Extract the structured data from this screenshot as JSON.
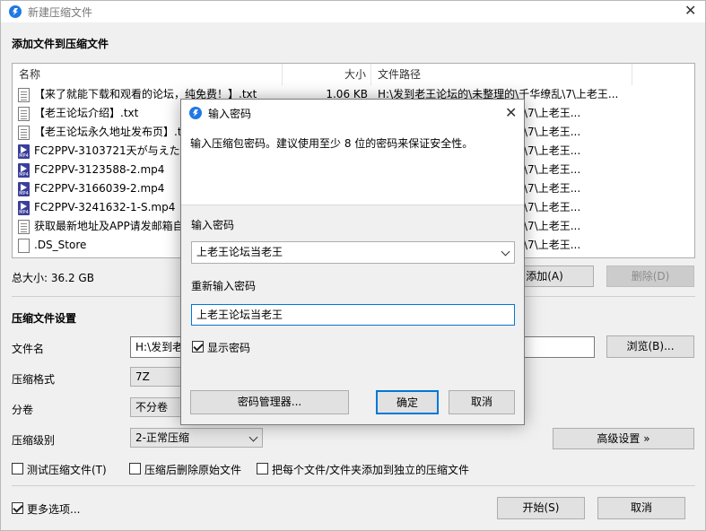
{
  "window": {
    "title": "新建压缩文件"
  },
  "add_section": {
    "title": "添加文件到压缩文件"
  },
  "file_list": {
    "columns": {
      "name": "名称",
      "size": "大小",
      "path": "文件路径"
    },
    "rows": [
      {
        "icon": "txt",
        "name": "【来了就能下载和观看的论坛，纯免费！】.txt",
        "size": "1.06 KB",
        "path": "H:\\发到老王论坛的\\未整理的\\千华缭乱\\7\\上老王..."
      },
      {
        "icon": "txt",
        "name": "【老王论坛介绍】.txt",
        "size": "",
        "path": "乱\\7\\上老王..."
      },
      {
        "icon": "txt",
        "name": "【老王论坛永久地址发布页】.tx",
        "size": "",
        "path": "乱\\7\\上老王..."
      },
      {
        "icon": "mp4",
        "name": "FC2PPV-3103721天が与えた",
        "size": "",
        "path": "乱\\7\\上老王..."
      },
      {
        "icon": "mp4",
        "name": "FC2PPV-3123588-2.mp4",
        "size": "",
        "path": "乱\\7\\上老王..."
      },
      {
        "icon": "mp4",
        "name": "FC2PPV-3166039-2.mp4",
        "size": "",
        "path": "乱\\7\\上老王..."
      },
      {
        "icon": "mp4",
        "name": "FC2PPV-3241632-1-S.mp4",
        "size": "",
        "path": "乱\\7\\上老王..."
      },
      {
        "icon": "txt",
        "name": "获取最新地址及APP请发邮箱自",
        "size": "",
        "path": "乱\\7\\上老王..."
      },
      {
        "icon": "blank",
        "name": ".DS_Store",
        "size": "",
        "path": "乱\\7\\上老王..."
      }
    ]
  },
  "total_size": "总大小: 36.2 GB",
  "buttons": {
    "add": "添加(A)",
    "delete": "删除(D)",
    "browse": "浏览(B)...",
    "advanced": "高级设置 »",
    "start": "开始(S)",
    "cancel": "取消"
  },
  "settings": {
    "title": "压缩文件设置",
    "filename_label": "文件名",
    "filename_value": "H:\\发到老",
    "format_label": "压缩格式",
    "format_value": "7Z",
    "split_label": "分卷",
    "split_value": "不分卷",
    "level_label": "压缩级别",
    "level_value": "2-正常压缩"
  },
  "options": {
    "test": "测试压缩文件(T)",
    "delete_after": "压缩后删除原始文件",
    "each_separate": "把每个文件/文件夹添加到独立的压缩文件",
    "more": "更多选项..."
  },
  "dialog": {
    "title": "输入密码",
    "description": "输入压缩包密码。建议使用至少 8 位的密码来保证安全性。",
    "password_label": "输入密码",
    "password_value": "上老王论坛当老王",
    "confirm_label": "重新输入密码",
    "confirm_value": "上老王论坛当老王",
    "show_password": "显示密码",
    "manager_button": "密码管理器...",
    "ok_button": "确定",
    "cancel_button": "取消"
  },
  "colors": {
    "accent": "#1e78e6",
    "focus_border": "#0078d7",
    "mp4_icon": "#3b3f9b"
  }
}
